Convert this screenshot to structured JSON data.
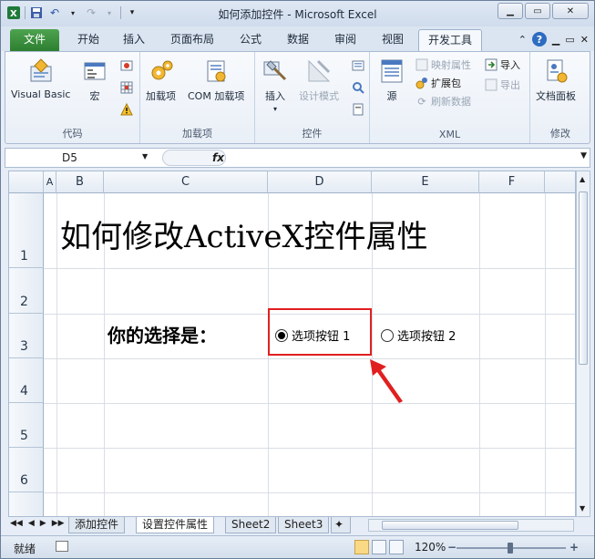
{
  "window": {
    "title": "如何添加控件 - Microsoft Excel"
  },
  "ribbon_tabs": [
    {
      "label": "文件"
    },
    {
      "label": "开始"
    },
    {
      "label": "插入"
    },
    {
      "label": "页面布局"
    },
    {
      "label": "公式"
    },
    {
      "label": "数据"
    },
    {
      "label": "审阅"
    },
    {
      "label": "视图"
    },
    {
      "label": "开发工具"
    }
  ],
  "groups": {
    "code": {
      "label": "代码",
      "visual_basic": "Visual Basic",
      "macro": "宏"
    },
    "addins": {
      "label": "加载项",
      "addins": "加载项",
      "com_addins": "COM 加载项"
    },
    "controls": {
      "label": "控件",
      "insert": "插入",
      "design_mode": "设计模式"
    },
    "xml": {
      "label": "XML",
      "source": "源",
      "map_properties": "映射属性",
      "expansion": "扩展包",
      "refresh": "刷新数据",
      "import": "导入",
      "export": "导出"
    },
    "modify": {
      "label": "修改",
      "doc_panel": "文档面板"
    }
  },
  "formula_bar": {
    "name_box": "D5",
    "fx": "fx"
  },
  "columns": [
    "A",
    "B",
    "C",
    "D",
    "E",
    "F"
  ],
  "rows": [
    "1",
    "2",
    "3",
    "4",
    "5",
    "6"
  ],
  "cells": {
    "title": "如何修改ActiveX控件属性",
    "prompt": "你的选择是：",
    "option1": "选项按钮 1",
    "option2": "选项按钮 2"
  },
  "sheets": [
    {
      "label": "添加控件",
      "active": false
    },
    {
      "label": "设置控件属性",
      "active": true
    },
    {
      "label": "Sheet2",
      "active": false
    },
    {
      "label": "Sheet3",
      "active": false
    }
  ],
  "status": {
    "ready": "就绪",
    "zoom": "120%"
  },
  "colors": {
    "accent_red": "#e02020",
    "file_tab": "#2c7f30"
  }
}
